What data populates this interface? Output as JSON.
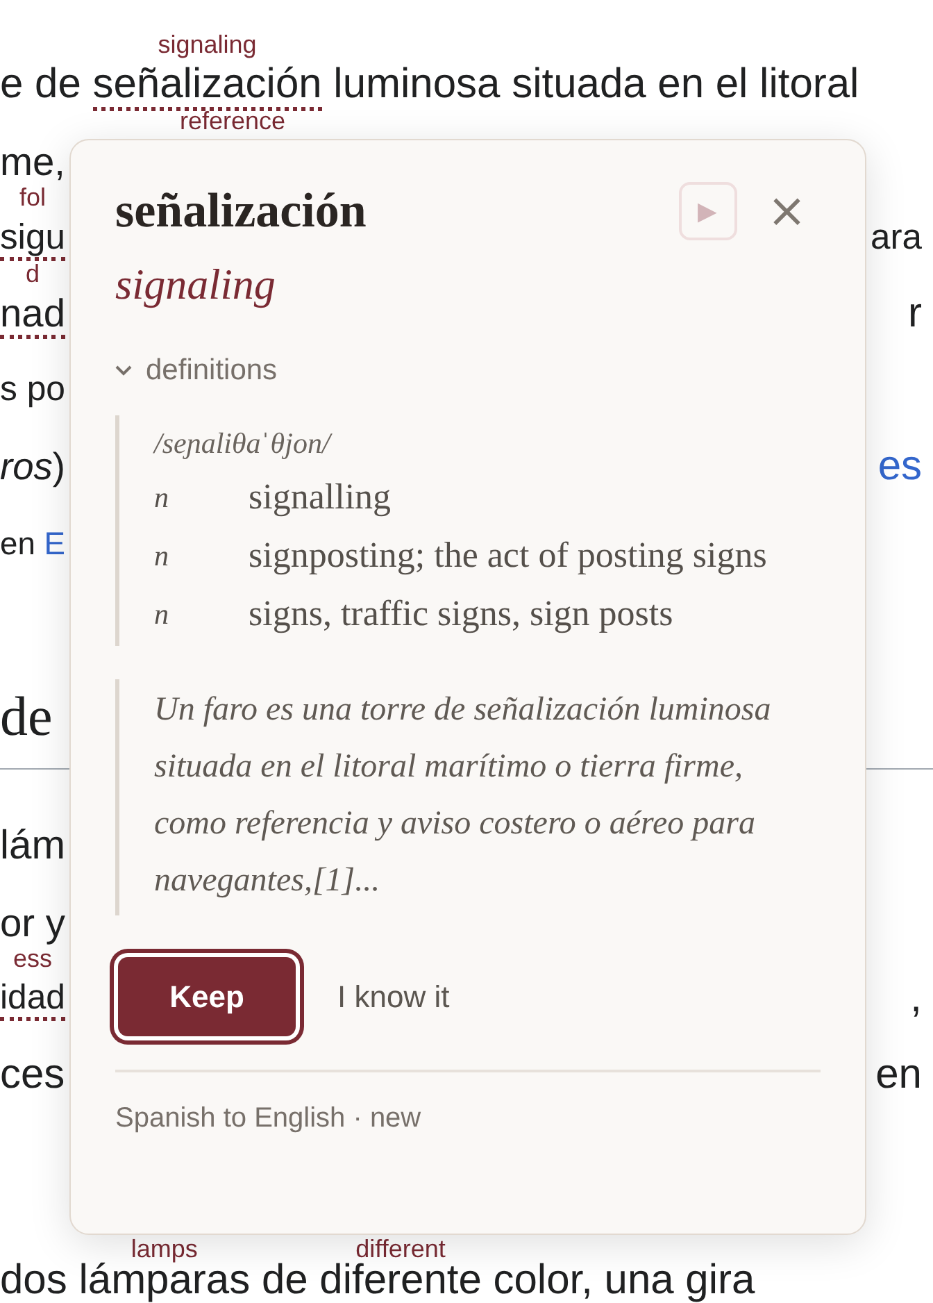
{
  "article": {
    "paragraph_1": [
      {
        "left": [
          {
            "text": "e de "
          },
          {
            "text": "señalización",
            "gloss": "signaling",
            "marked": true
          },
          {
            "text": " luminosa situada en el litoral"
          }
        ]
      },
      {
        "left": [
          {
            "text": "me,"
          },
          {
            "gloss": "reference"
          }
        ]
      },
      {
        "left": [
          {
            "text": "sigu",
            "gloss": "fol",
            "marked": true
          }
        ],
        "right": [
          {
            "text": "ara"
          }
        ]
      },
      {
        "left": [
          {
            "text": "nad",
            "gloss": "d",
            "marked": true
          }
        ],
        "right": [
          {
            "text": "r"
          }
        ]
      },
      {
        "left": [
          {
            "text": "s po"
          }
        ]
      },
      {
        "left": [
          {
            "text": "ros",
            "kind": "italic"
          },
          {
            "text": ")"
          }
        ],
        "right": [
          {
            "text": "es",
            "kind": "link"
          }
        ]
      },
      {
        "left": [
          {
            "text": "en "
          },
          {
            "text": "E",
            "kind": "link"
          }
        ]
      }
    ],
    "heading": "de",
    "paragraph_2": [
      {
        "left": [
          {
            "text": "lám"
          }
        ]
      },
      {
        "left": [
          {
            "text": "or y"
          }
        ]
      },
      {
        "left": [
          {
            "text": "idad",
            "gloss": "ess",
            "marked": true
          }
        ],
        "right": [
          {
            "text": ","
          }
        ]
      },
      {
        "left": [
          {
            "text": "ces"
          }
        ],
        "right": [
          {
            "text": "en"
          }
        ]
      }
    ],
    "paragraph_3": [
      {
        "left": [
          {
            "text": "dos "
          },
          {
            "text": "lámparas",
            "gloss": "lamps"
          },
          {
            "text": " de "
          },
          {
            "text": "diferente",
            "gloss": "different"
          },
          {
            "text": " color, una gira"
          }
        ]
      }
    ]
  },
  "popup": {
    "word": "señalización",
    "translation": "signaling",
    "play_icon": "▶",
    "close_icon": "×",
    "definitions": {
      "label": "definitions",
      "expanded": true,
      "pronunciation": "/seɲaliθaˈθjon/",
      "senses": [
        {
          "pos": "n",
          "meaning": "signalling"
        },
        {
          "pos": "n",
          "meaning": "signposting; the act of posting signs"
        },
        {
          "pos": "n",
          "meaning": "signs, traffic signs, sign posts"
        }
      ]
    },
    "excerpt": "Un faro es una torre de señalización luminosa situada en el litoral marítimo o tierra firme, como referencia y aviso costero o aéreo para navegantes,[1]...",
    "buttons": [
      {
        "label": "Keep",
        "kind": "primary"
      },
      {
        "label": "I know it",
        "kind": "plain"
      }
    ],
    "footer": "Spanish to English · new"
  }
}
